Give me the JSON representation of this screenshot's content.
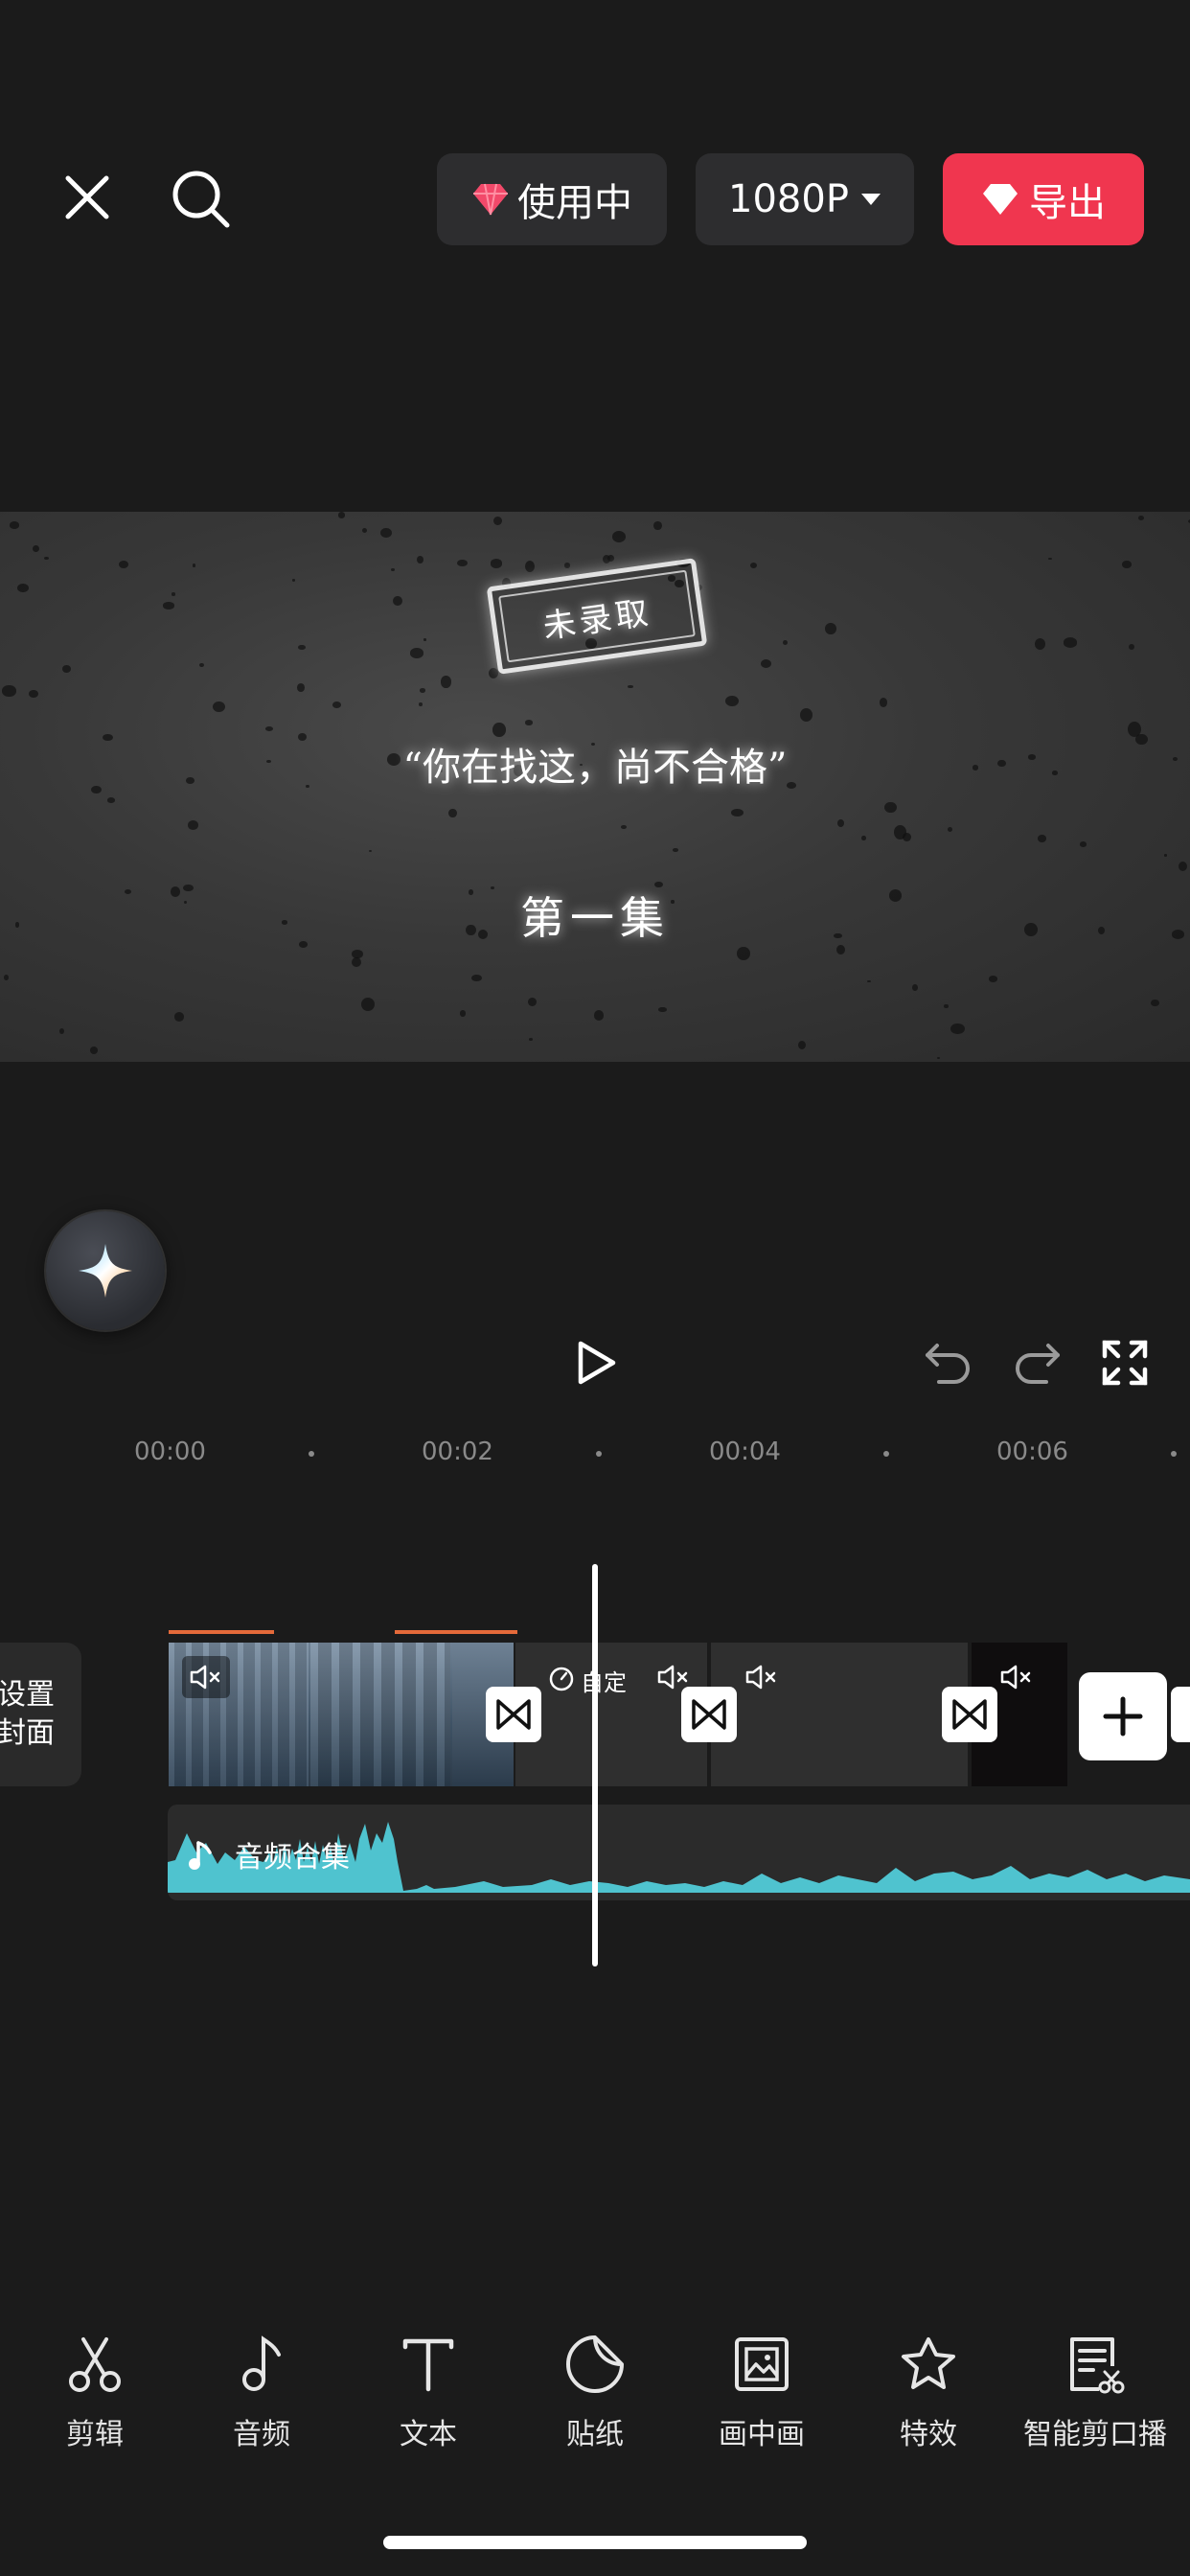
{
  "topbar": {
    "close_icon": "close-icon",
    "search_icon": "search-icon",
    "pro_label": "使用中",
    "resolution_label": "1080P",
    "export_label": "导出",
    "export_color": "#f0364f",
    "diamond_color": "#f2496a"
  },
  "preview": {
    "stamp_text": "未录取",
    "quote_text": "“你在找这，尚不合格”",
    "episode_text": "第一集"
  },
  "ai_button": {
    "icon": "sparkle-icon"
  },
  "controls": {
    "play_icon": "play-icon",
    "undo_icon": "undo-icon",
    "redo_icon": "redo-icon",
    "fullscreen_icon": "fullscreen-icon"
  },
  "ruler": {
    "labels": [
      "00:00",
      "00:02",
      "00:04",
      "00:06"
    ]
  },
  "timeline": {
    "cover_line1": "设置",
    "cover_line2": "封面",
    "speed_label": "自定",
    "audio_label": "音频合集",
    "audio_color": "#4fc3cf"
  },
  "toolbar": {
    "items": [
      {
        "label": "剪辑",
        "icon": "scissors-icon"
      },
      {
        "label": "音频",
        "icon": "music-note-icon"
      },
      {
        "label": "文本",
        "icon": "text-icon"
      },
      {
        "label": "贴纸",
        "icon": "sticker-icon"
      },
      {
        "label": "画中画",
        "icon": "picture-in-picture-icon"
      },
      {
        "label": "特效",
        "icon": "effects-star-icon"
      },
      {
        "label": "智能剪口播",
        "icon": "smart-cut-icon"
      }
    ]
  }
}
